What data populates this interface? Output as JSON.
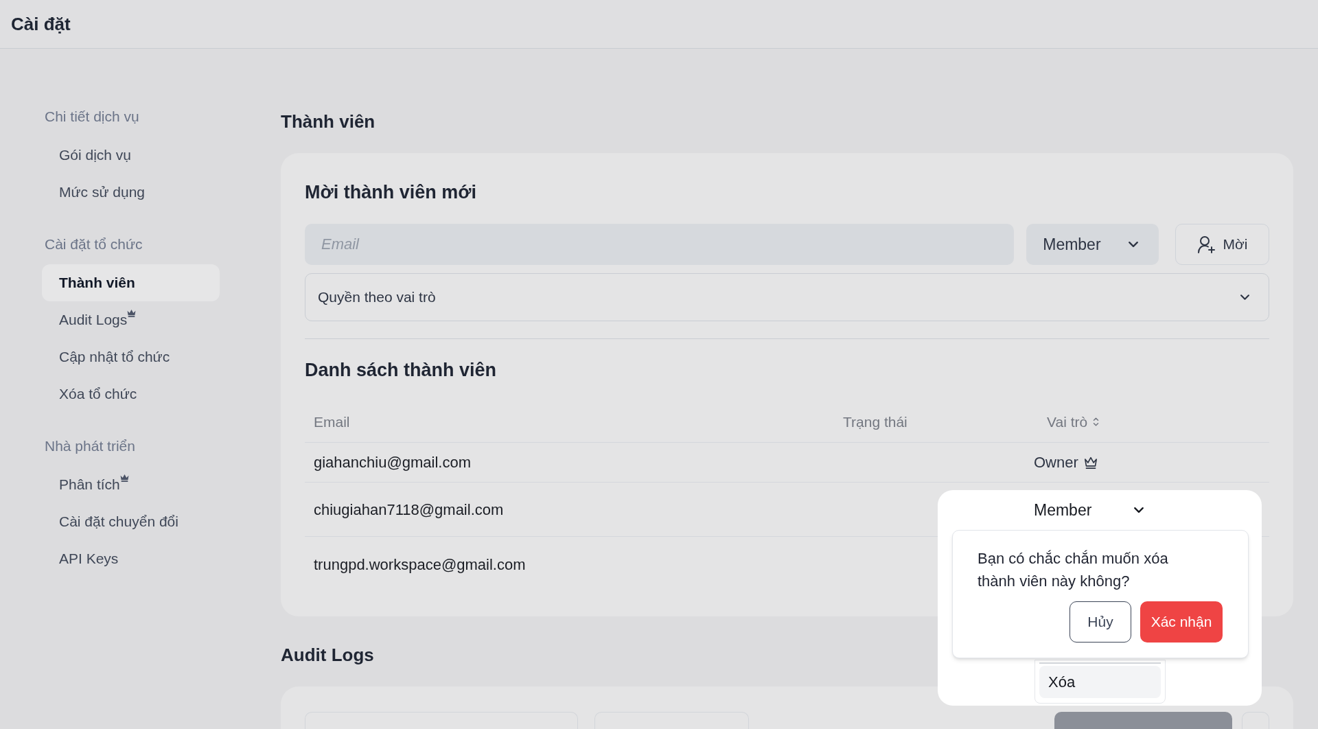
{
  "header": {
    "title": "Cài đặt"
  },
  "sidebar": {
    "sections": [
      {
        "label": "Chi tiết dịch vụ",
        "items": [
          {
            "label": "Gói dịch vụ",
            "selected": false,
            "premium": false
          },
          {
            "label": "Mức sử dụng",
            "selected": false,
            "premium": false
          }
        ]
      },
      {
        "label": "Cài đặt tổ chức",
        "items": [
          {
            "label": "Thành viên",
            "selected": true,
            "premium": false
          },
          {
            "label": "Audit Logs",
            "selected": false,
            "premium": true
          },
          {
            "label": "Cập nhật tổ chức",
            "selected": false,
            "premium": false
          },
          {
            "label": "Xóa tổ chức",
            "selected": false,
            "premium": false
          }
        ]
      },
      {
        "label": "Nhà phát triển",
        "items": [
          {
            "label": "Phân tích",
            "selected": false,
            "premium": true
          },
          {
            "label": "Cài đặt chuyển đổi",
            "selected": false,
            "premium": false
          },
          {
            "label": "API Keys",
            "selected": false,
            "premium": false
          }
        ]
      }
    ]
  },
  "members_page": {
    "title": "Thành viên",
    "invite": {
      "title": "Mời thành viên mới",
      "email_field": {
        "placeholder": "Email"
      },
      "role_select": {
        "value": "Member"
      },
      "invite_button": {
        "label": "Mời"
      },
      "permissions_select": {
        "label": "Quyền theo vai trò"
      }
    },
    "member_list": {
      "title": "Danh sách thành viên",
      "columns": [
        {
          "label": "Email",
          "sortable": false
        },
        {
          "label": "Trạng thái",
          "sortable": false
        },
        {
          "label": "Vai trò",
          "sortable": true
        }
      ],
      "rows": [
        {
          "email": "giahanchiu@gmail.com",
          "kind": "owner",
          "role": "Owner"
        },
        {
          "email": "chiugiahan7118@gmail.com",
          "kind": "member"
        },
        {
          "email": "trungpd.workspace@gmail.com",
          "kind": "member"
        }
      ]
    }
  },
  "role_popover": {
    "role_select": {
      "value": "Member"
    },
    "menu_items": [
      {
        "label": "Xóa",
        "selected": true
      }
    ],
    "confirm_dialog": {
      "message": "Bạn có chắc chắn muốn xóa thành viên này không?",
      "buttons": [
        {
          "label": "Hủy",
          "kind": "cancel"
        },
        {
          "label": "Xác nhận",
          "kind": "confirm"
        }
      ]
    }
  },
  "audit_logs": {
    "title": "Audit Logs"
  }
}
